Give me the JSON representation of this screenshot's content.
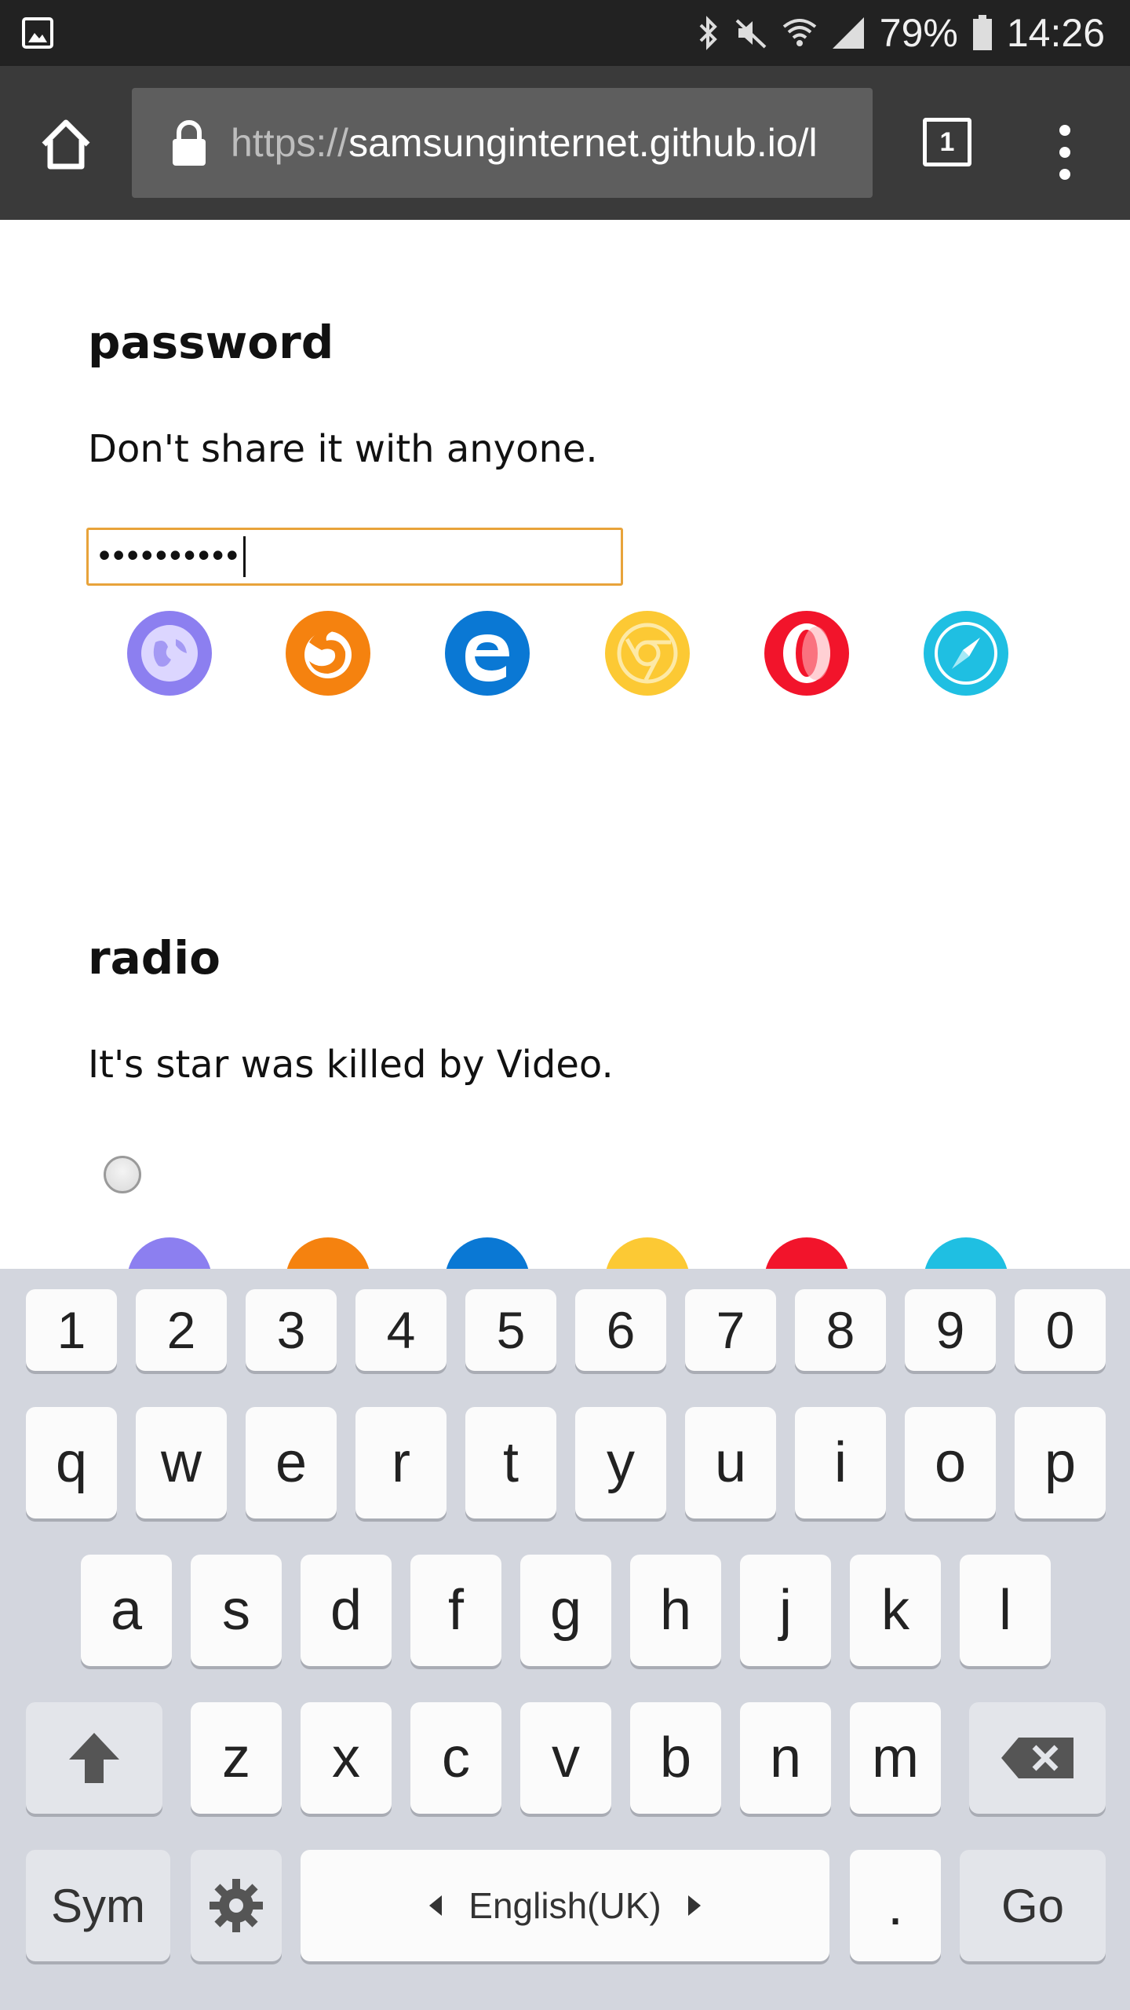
{
  "status_bar": {
    "battery": "79%",
    "time": "14:26",
    "icons": [
      "gallery-notification-icon",
      "bluetooth-icon",
      "mute-icon",
      "wifi-icon",
      "signal-icon",
      "battery-icon"
    ]
  },
  "browser": {
    "url_scheme": "https://",
    "url_host": "samsunginternet.github.io/l",
    "tab_count": "1",
    "icons": [
      "home-icon",
      "lock-icon",
      "tabs-icon",
      "more-menu-icon"
    ]
  },
  "sections": {
    "password": {
      "title": "password",
      "description": "Don't share it with anyone.",
      "input_value": "••••••••••"
    },
    "radio": {
      "title": "radio",
      "description": "It's star was killed by Video."
    }
  },
  "browser_support_icons": [
    "samsung-internet",
    "firefox",
    "edge",
    "chrome",
    "opera",
    "safari"
  ],
  "colors": {
    "accent_focus": "#e8a33a",
    "samsung": "#8c7ff0",
    "firefox": "#f5820f",
    "edge": "#0a78d4",
    "chrome": "#fcc934",
    "opera": "#f2142b",
    "safari": "#1fbfe2"
  },
  "keyboard": {
    "numbers": [
      "1",
      "2",
      "3",
      "4",
      "5",
      "6",
      "7",
      "8",
      "9",
      "0"
    ],
    "row1": [
      "q",
      "w",
      "e",
      "r",
      "t",
      "y",
      "u",
      "i",
      "o",
      "p"
    ],
    "row2": [
      "a",
      "s",
      "d",
      "f",
      "g",
      "h",
      "j",
      "k",
      "l"
    ],
    "row3": [
      "z",
      "x",
      "c",
      "v",
      "b",
      "n",
      "m"
    ],
    "sym_label": "Sym",
    "space_label": "English(UK)",
    "period_label": ".",
    "go_label": "Go"
  }
}
